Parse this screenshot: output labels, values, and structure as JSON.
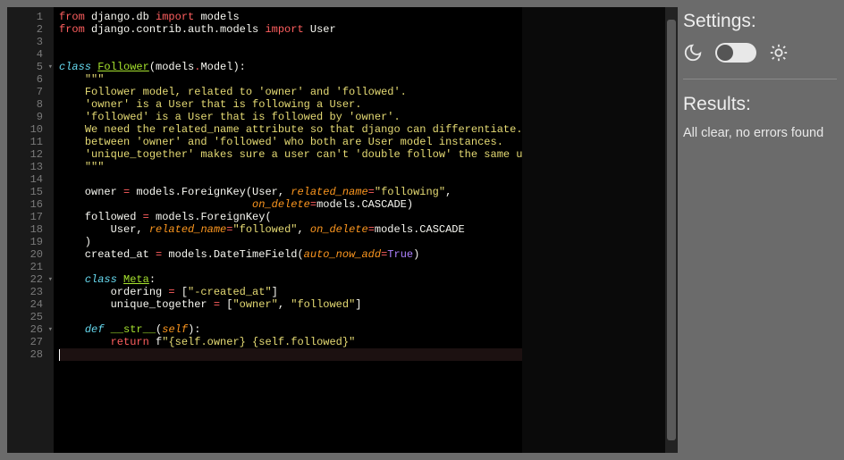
{
  "editor": {
    "line_count": 28,
    "active_line": 28,
    "fold_lines": [
      5,
      22,
      26
    ],
    "lines": [
      [
        [
          "hl-kw",
          "from"
        ],
        [
          "hl-id",
          " django.db "
        ],
        [
          "hl-kw",
          "import"
        ],
        [
          "hl-id",
          " models"
        ]
      ],
      [
        [
          "hl-kw",
          "from"
        ],
        [
          "hl-id",
          " django.contrib.auth.models "
        ],
        [
          "hl-kw",
          "import"
        ],
        [
          "hl-id",
          " User"
        ]
      ],
      [],
      [],
      [
        [
          "hl-kw2",
          "class"
        ],
        [
          "hl-id",
          " "
        ],
        [
          "hl-cls",
          "Follower"
        ],
        [
          "hl-id",
          "(models"
        ],
        [
          "hl-op",
          "."
        ],
        [
          "hl-id",
          "Model):"
        ]
      ],
      [
        [
          "hl-id",
          "    "
        ],
        [
          "hl-str",
          "\"\"\""
        ]
      ],
      [
        [
          "hl-id",
          "    "
        ],
        [
          "hl-str",
          "Follower model, related to 'owner' and 'followed'."
        ]
      ],
      [
        [
          "hl-id",
          "    "
        ],
        [
          "hl-str",
          "'owner' is a User that is following a User."
        ]
      ],
      [
        [
          "hl-id",
          "    "
        ],
        [
          "hl-str",
          "'followed' is a User that is followed by 'owner'."
        ]
      ],
      [
        [
          "hl-id",
          "    "
        ],
        [
          "hl-str",
          "We need the related_name attribute so that django can differentiate."
        ]
      ],
      [
        [
          "hl-id",
          "    "
        ],
        [
          "hl-str",
          "between 'owner' and 'followed' who both are User model instances."
        ]
      ],
      [
        [
          "hl-id",
          "    "
        ],
        [
          "hl-str",
          "'unique_together' makes sure a user can't 'double follow' the same user."
        ]
      ],
      [
        [
          "hl-id",
          "    "
        ],
        [
          "hl-str",
          "\"\"\""
        ]
      ],
      [],
      [
        [
          "hl-id",
          "    owner "
        ],
        [
          "hl-op",
          "="
        ],
        [
          "hl-id",
          " models.ForeignKey(User, "
        ],
        [
          "hl-arg",
          "related_name"
        ],
        [
          "hl-op",
          "="
        ],
        [
          "hl-str",
          "\"following\""
        ],
        [
          "hl-id",
          ","
        ]
      ],
      [
        [
          "hl-id",
          "                              "
        ],
        [
          "hl-arg",
          "on_delete"
        ],
        [
          "hl-op",
          "="
        ],
        [
          "hl-id",
          "models.CASCADE)"
        ]
      ],
      [
        [
          "hl-id",
          "    followed "
        ],
        [
          "hl-op",
          "="
        ],
        [
          "hl-id",
          " models.ForeignKey("
        ]
      ],
      [
        [
          "hl-id",
          "        User, "
        ],
        [
          "hl-arg",
          "related_name"
        ],
        [
          "hl-op",
          "="
        ],
        [
          "hl-str",
          "\"followed\""
        ],
        [
          "hl-id",
          ", "
        ],
        [
          "hl-arg",
          "on_delete"
        ],
        [
          "hl-op",
          "="
        ],
        [
          "hl-id",
          "models.CASCADE"
        ]
      ],
      [
        [
          "hl-id",
          "    )"
        ]
      ],
      [
        [
          "hl-id",
          "    created_at "
        ],
        [
          "hl-op",
          "="
        ],
        [
          "hl-id",
          " models.DateTimeField("
        ],
        [
          "hl-arg",
          "auto_now_add"
        ],
        [
          "hl-op",
          "="
        ],
        [
          "hl-num",
          "True"
        ],
        [
          "hl-id",
          ")"
        ]
      ],
      [],
      [
        [
          "hl-id",
          "    "
        ],
        [
          "hl-kw2",
          "class"
        ],
        [
          "hl-id",
          " "
        ],
        [
          "hl-cls",
          "Meta"
        ],
        [
          "hl-id",
          ":"
        ]
      ],
      [
        [
          "hl-id",
          "        ordering "
        ],
        [
          "hl-op",
          "="
        ],
        [
          "hl-id",
          " ["
        ],
        [
          "hl-str",
          "\"-created_at\""
        ],
        [
          "hl-id",
          "]"
        ]
      ],
      [
        [
          "hl-id",
          "        unique_together "
        ],
        [
          "hl-op",
          "="
        ],
        [
          "hl-id",
          " ["
        ],
        [
          "hl-str",
          "\"owner\""
        ],
        [
          "hl-id",
          ", "
        ],
        [
          "hl-str",
          "\"followed\""
        ],
        [
          "hl-id",
          "]"
        ]
      ],
      [],
      [
        [
          "hl-id",
          "    "
        ],
        [
          "hl-kw2",
          "def"
        ],
        [
          "hl-id",
          " "
        ],
        [
          "hl-fn",
          "__str__"
        ],
        [
          "hl-id",
          "("
        ],
        [
          "hl-arg",
          "self"
        ],
        [
          "hl-id",
          "):"
        ]
      ],
      [
        [
          "hl-id",
          "        "
        ],
        [
          "hl-kw",
          "return"
        ],
        [
          "hl-id",
          " f"
        ],
        [
          "hl-str",
          "\"{self.owner} {self.followed}\""
        ]
      ],
      []
    ]
  },
  "sidebar": {
    "settings_title": "Settings:",
    "results_title": "Results:",
    "results_text": "All clear, no errors found",
    "theme_switch_on": false
  }
}
